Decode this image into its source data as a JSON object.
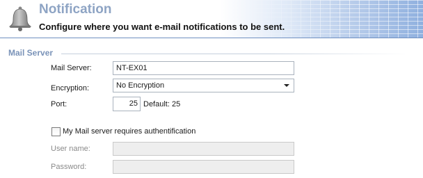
{
  "header": {
    "title": "Notification",
    "subtitle": "Configure where you want e-mail notifications to be sent.",
    "icon": "bell-icon"
  },
  "mail_server_section": {
    "title": "Mail Server",
    "server_label": "Mail Server:",
    "server_value": "NT-EX01",
    "encryption_label": "Encryption:",
    "encryption_value": "No Encryption",
    "port_label": "Port:",
    "port_value": "25",
    "port_default_label": "Default: 25",
    "auth_checkbox_label": "My Mail server requires authentification",
    "auth_checked": false,
    "username_label": "User name:",
    "username_value": "",
    "password_label": "Password:",
    "password_value": ""
  },
  "colors": {
    "title": "#8ea4c4",
    "section_title": "#7a93b8",
    "header_gradient_end": "#8fb0df"
  }
}
